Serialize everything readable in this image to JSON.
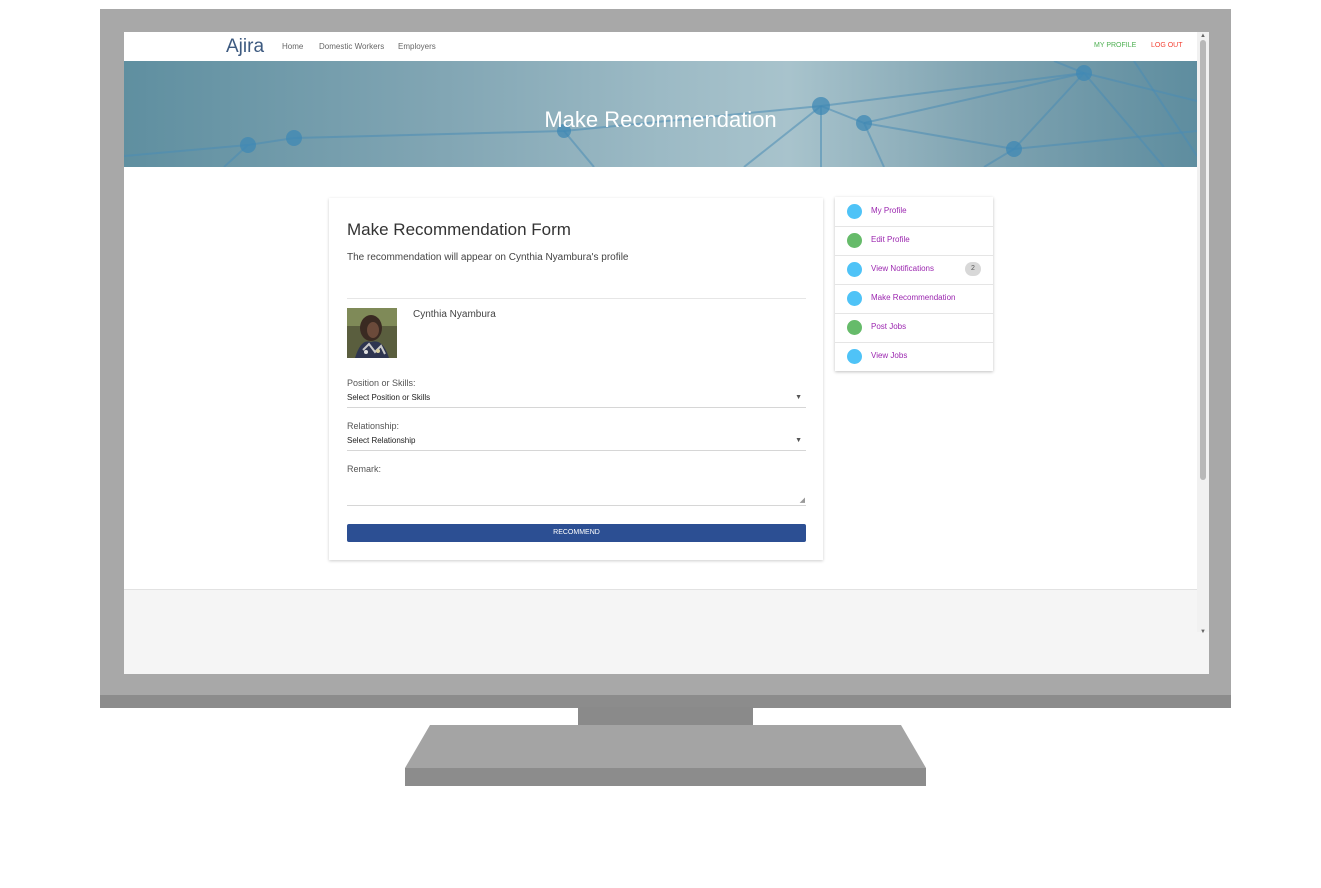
{
  "nav": {
    "brand": "Ajira",
    "links": [
      "Home",
      "Domestic Workers",
      "Employers"
    ],
    "my_profile": "MY PROFILE",
    "logout": "LOG OUT"
  },
  "hero": {
    "title": "Make Recommendation"
  },
  "form": {
    "title": "Make Recommendation Form",
    "subtitle": "The recommendation will appear on Cynthia Nyambura's profile",
    "person_name": "Cynthia Nyambura",
    "position_label": "Position or Skills:",
    "position_value": "Select Position or Skills",
    "relationship_label": "Relationship:",
    "relationship_value": "Select Relationship",
    "remark_label": "Remark:",
    "remark_value": "",
    "submit_label": "RECOMMEND"
  },
  "sidebar": {
    "items": [
      {
        "label": "My Profile",
        "icon": "profile-card-icon",
        "color": "#4fc3f7"
      },
      {
        "label": "Edit Profile",
        "icon": "edit-profile-icon",
        "color": "#66bb6a"
      },
      {
        "label": "View Notifications",
        "icon": "notifications-icon",
        "color": "#4fc3f7",
        "badge": "2"
      },
      {
        "label": "Make Recommendation",
        "icon": "recommendation-icon",
        "color": "#4fc3f7"
      },
      {
        "label": "Post Jobs",
        "icon": "post-jobs-icon",
        "color": "#66bb6a"
      },
      {
        "label": "View Jobs",
        "icon": "view-jobs-icon",
        "color": "#4fc3f7"
      }
    ]
  },
  "colors": {
    "brand": "#3d5a80",
    "my_profile": "#4caf50",
    "logout": "#f44336",
    "sidebar_link": "#9c27b0",
    "button": "#2c4f93"
  }
}
